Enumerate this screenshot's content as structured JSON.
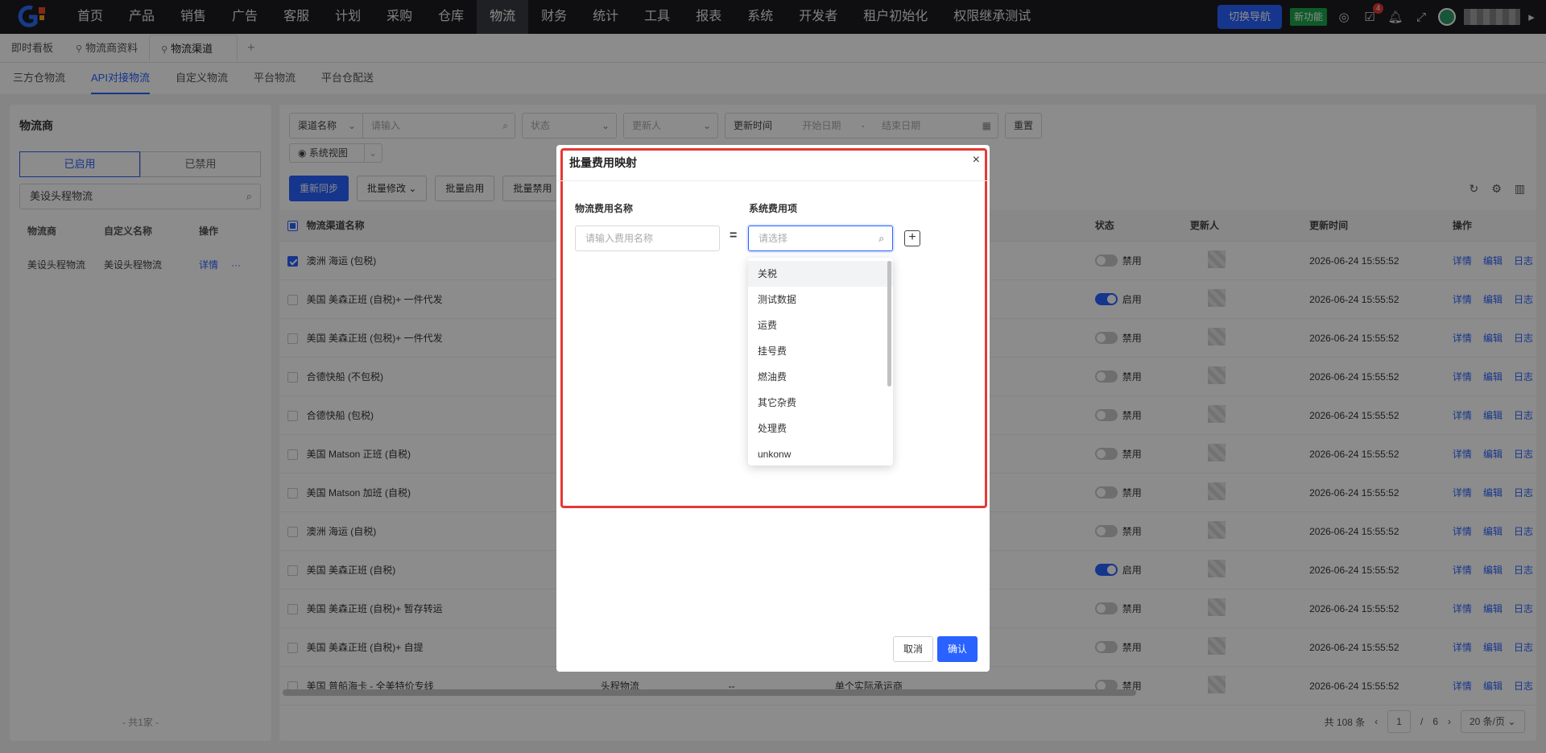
{
  "nav": {
    "items": [
      "首页",
      "产品",
      "销售",
      "广告",
      "客服",
      "计划",
      "采购",
      "仓库",
      "物流",
      "财务",
      "统计",
      "工具",
      "报表",
      "系统",
      "开发者",
      "租户初始化",
      "权限继承测试"
    ],
    "active_index": 8,
    "badge": "gxj",
    "switch_label": "切换导航",
    "new_feature_label": "新功能",
    "message_count": "4"
  },
  "tabs": {
    "items": [
      "即时看板",
      "物流商资料",
      "物流渠道"
    ],
    "add": "+"
  },
  "subtabs": [
    "三方仓物流",
    "API对接物流",
    "自定义物流",
    "平台物流",
    "平台仓配送"
  ],
  "left": {
    "title": "物流商",
    "seg_on": "已启用",
    "seg_off": "已禁用",
    "search_value": "美设头程物流",
    "headers": [
      "物流商",
      "自定义名称",
      "操作"
    ],
    "row": {
      "provider": "美设头程物流",
      "custom": "美设头程物流",
      "detail": "详情",
      "more": "···"
    },
    "total": "- 共1家 -"
  },
  "filters": {
    "channel_label": "渠道名称",
    "channel_placeholder": "请输入",
    "status_placeholder": "状态",
    "updater_placeholder": "更新人",
    "time_label": "更新时间",
    "start_placeholder": "开始日期",
    "dash": "-",
    "end_placeholder": "结束日期",
    "reset": "重置",
    "view": "系统视图"
  },
  "actions": [
    "重新同步",
    "批量修改",
    "批量启用",
    "批量禁用"
  ],
  "table": {
    "headers": {
      "name": "物流渠道名称",
      "status": "状态",
      "updater": "更新人",
      "time": "更新时间",
      "ops": "操作"
    },
    "ops": [
      "详情",
      "编辑",
      "日志"
    ],
    "rows": [
      {
        "name": "澳洲 海运 (包税)",
        "status": "禁用",
        "on": false,
        "checked": true,
        "time": "2026-06-24 15:55:52"
      },
      {
        "name": "美国 美森正班 (自税)+ 一件代发",
        "status": "启用",
        "on": true,
        "checked": false,
        "time": "2026-06-24 15:55:52"
      },
      {
        "name": "美国 美森正班 (包税)+ 一件代发",
        "status": "禁用",
        "on": false,
        "checked": false,
        "time": "2026-06-24 15:55:52"
      },
      {
        "name": "合德快船 (不包税)",
        "status": "禁用",
        "on": false,
        "checked": false,
        "time": "2026-06-24 15:55:52"
      },
      {
        "name": "合德快船 (包税)",
        "status": "禁用",
        "on": false,
        "checked": false,
        "time": "2026-06-24 15:55:52"
      },
      {
        "name": "美国 Matson 正班 (自税)",
        "status": "禁用",
        "on": false,
        "checked": false,
        "time": "2026-06-24 15:55:52"
      },
      {
        "name": "美国 Matson 加班 (自税)",
        "status": "禁用",
        "on": false,
        "checked": false,
        "time": "2026-06-24 15:55:52"
      },
      {
        "name": "澳洲 海运 (自税)",
        "status": "禁用",
        "on": false,
        "checked": false,
        "time": "2026-06-24 15:55:52"
      },
      {
        "name": "美国 美森正班 (自税)",
        "status": "启用",
        "on": true,
        "checked": false,
        "time": "2026-06-24 15:55:52"
      },
      {
        "name": "美国 美森正班 (自税)+ 暂存转运",
        "status": "禁用",
        "on": false,
        "checked": false,
        "time": "2026-06-24 15:55:52"
      },
      {
        "name": "美国 美森正班 (自税)+ 自提",
        "status": "禁用",
        "on": false,
        "checked": false,
        "time": "2026-06-24 15:55:52"
      },
      {
        "name": "美国 普船海卡 - 全美特价专线",
        "status": "禁用",
        "on": false,
        "checked": false,
        "time": "2026-06-24 15:55:52",
        "type": "头程物流",
        "x": "--",
        "kind": "单个实际承运商"
      }
    ]
  },
  "pager": {
    "total": "共 108 条",
    "prev": "‹",
    "page": "1",
    "sep": "/",
    "pages": "6",
    "next": "›",
    "size": "20 条/页"
  },
  "modal": {
    "title": "批量费用映射",
    "close": "×",
    "left_label": "物流费用名称",
    "left_placeholder": "请输入费用名称",
    "eq": "=",
    "right_label": "系统费用项",
    "right_placeholder": "请选择",
    "options": [
      "关税",
      "测试数据",
      "运费",
      "挂号费",
      "燃油费",
      "其它杂费",
      "处理费",
      "unkonw"
    ],
    "cancel": "取消",
    "confirm": "确认"
  }
}
